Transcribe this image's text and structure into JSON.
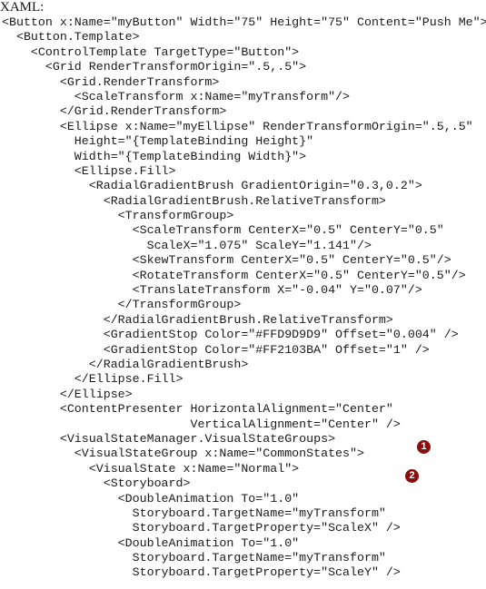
{
  "heading": "XAML:",
  "code_lines": [
    "<Button x:Name=\"myButton\" Width=\"75\" Height=\"75\" Content=\"Push Me\">",
    "  <Button.Template>",
    "    <ControlTemplate TargetType=\"Button\">",
    "      <Grid RenderTransformOrigin=\".5,.5\">",
    "        <Grid.RenderTransform>",
    "          <ScaleTransform x:Name=\"myTransform\"/>",
    "        </Grid.RenderTransform>",
    "        <Ellipse x:Name=\"myEllipse\" RenderTransformOrigin=\".5,.5\"",
    "          Height=\"{TemplateBinding Height}\"",
    "          Width=\"{TemplateBinding Width}\">",
    "          <Ellipse.Fill>",
    "            <RadialGradientBrush GradientOrigin=\"0.3,0.2\">",
    "              <RadialGradientBrush.RelativeTransform>",
    "                <TransformGroup>",
    "                  <ScaleTransform CenterX=\"0.5\" CenterY=\"0.5\"",
    "                    ScaleX=\"1.075\" ScaleY=\"1.141\"/>",
    "                  <SkewTransform CenterX=\"0.5\" CenterY=\"0.5\"/>",
    "                  <RotateTransform CenterX=\"0.5\" CenterY=\"0.5\"/>",
    "                  <TranslateTransform X=\"-0.04\" Y=\"0.07\"/>",
    "                </TransformGroup>",
    "              </RadialGradientBrush.RelativeTransform>",
    "              <GradientStop Color=\"#FFD9D9D9\" Offset=\"0.004\" />",
    "              <GradientStop Color=\"#FF2103BA\" Offset=\"1\" />",
    "            </RadialGradientBrush>",
    "          </Ellipse.Fill>",
    "        </Ellipse>",
    "        <ContentPresenter HorizontalAlignment=\"Center\"",
    "                          VerticalAlignment=\"Center\" />",
    "        <VisualStateManager.VisualStateGroups>",
    "          <VisualStateGroup x:Name=\"CommonStates\">",
    "            <VisualState x:Name=\"Normal\">",
    "              <Storyboard>",
    "                <DoubleAnimation To=\"1.0\"",
    "                  Storyboard.TargetName=\"myTransform\"",
    "                  Storyboard.TargetProperty=\"ScaleX\" />",
    "                <DoubleAnimation To=\"1.0\"",
    "                  Storyboard.TargetName=\"myTransform\"",
    "                  Storyboard.TargetProperty=\"ScaleY\" />"
  ],
  "callouts": [
    {
      "label": "1",
      "color": "#8B0E0E"
    },
    {
      "label": "2",
      "color": "#8B0E0E"
    }
  ]
}
